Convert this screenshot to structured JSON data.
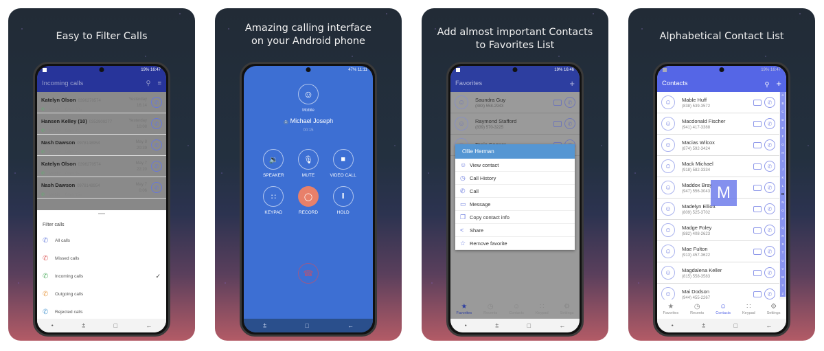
{
  "cards": [
    {
      "title": "Easy to Filter Calls",
      "status": {
        "signal": "… .il .il",
        "battery": "19%",
        "time": "16:47"
      },
      "appbar": {
        "title": "Incoming calls"
      },
      "calls": [
        {
          "name": "Katelyn Olson",
          "number": "0396270574",
          "type": "Mobile",
          "duration": "0min 20s",
          "date": "Yesterday",
          "time": "16:14"
        },
        {
          "name": "Hansen Kelley (10)",
          "number": "0352909277",
          "type": "Mobile",
          "duration": "0min 8s",
          "date": "Yesterday",
          "time": "10:08"
        },
        {
          "name": "Nash Dawson",
          "number": "0978148954",
          "type": "Mobile",
          "duration": "0min 6s",
          "date": "May 8",
          "time": "20:39"
        },
        {
          "name": "Katelyn Olson",
          "number": "0396270574",
          "type": "Mobile",
          "duration": "0min 9s",
          "date": "May 7",
          "time": "22:20"
        },
        {
          "name": "Nash Dawson",
          "number": "0978148954",
          "type": "Mobile",
          "duration": "0min 15s",
          "date": "May 7",
          "time": "0:06"
        }
      ],
      "sheet": {
        "title": "Filter calls",
        "items": [
          {
            "label": "All calls",
            "color": "#7b8ee0",
            "selected": false
          },
          {
            "label": "Missed calls",
            "color": "#e06b6b",
            "selected": false
          },
          {
            "label": "Incoming calls",
            "color": "#5bb36b",
            "selected": true
          },
          {
            "label": "Outgoing calls",
            "color": "#e8a04f",
            "selected": false
          },
          {
            "label": "Rejected calls",
            "color": "#5a9fd4",
            "selected": false
          }
        ],
        "check": "✓"
      }
    },
    {
      "title": "Amazing calling interface on your Android phone",
      "status": {
        "battery": "47%",
        "time": "11:11"
      },
      "call": {
        "label": "Mobile",
        "sim": "1",
        "name": "Michael Joseph",
        "timer": "00:15",
        "buttons": [
          {
            "label": "SPEAKER",
            "icon": "🔉"
          },
          {
            "label": "MUTE",
            "icon": "🎙"
          },
          {
            "label": "VIDEO CALL",
            "icon": "■"
          },
          {
            "label": "KEYPAD",
            "icon": "∷"
          },
          {
            "label": "RECORD",
            "icon": "◯"
          },
          {
            "label": "HOLD",
            "icon": "‖"
          }
        ],
        "hangup_icon": "☎"
      }
    },
    {
      "title": "Add almost important Contacts to Favorites List",
      "status": {
        "battery": "19%",
        "time": "16:46"
      },
      "appbar": {
        "title": "Favorites",
        "add": "+"
      },
      "favorites": [
        {
          "name": "Saundra Guy",
          "phone": "(883) 558-2943"
        },
        {
          "name": "Raymond Stafford",
          "phone": "(839) 570-3225"
        },
        {
          "name": "Tania Conner",
          "phone": ""
        }
      ],
      "menu": {
        "title": "Ollie Herman",
        "items": [
          {
            "label": "View contact",
            "icon": "☺"
          },
          {
            "label": "Call History",
            "icon": "◷"
          },
          {
            "label": "Call",
            "icon": "✆"
          },
          {
            "label": "Message",
            "icon": "▭"
          },
          {
            "label": "Copy contact info",
            "icon": "❐"
          },
          {
            "label": "Share",
            "icon": "<"
          },
          {
            "label": "Remove favorite",
            "icon": "☆"
          }
        ]
      },
      "tabs": [
        {
          "label": "Favorites",
          "icon": "★",
          "active": true
        },
        {
          "label": "Recents",
          "icon": "◷",
          "active": false
        },
        {
          "label": "Contacts",
          "icon": "☺",
          "active": false
        },
        {
          "label": "Keypad",
          "icon": "∷",
          "active": false
        },
        {
          "label": "Settings",
          "icon": "⚙",
          "active": false
        }
      ]
    },
    {
      "title": "Alphabetical Contact List",
      "status": {
        "battery": "19%",
        "time": "16:47"
      },
      "appbar": {
        "title": "Contacts",
        "add": "+"
      },
      "contacts": [
        {
          "name": "Mable Huff",
          "phone": "(838) 539-3572"
        },
        {
          "name": "Macdonald Fischer",
          "phone": "(941) 417-3388"
        },
        {
          "name": "Macias Wilcox",
          "phone": "(874) 592-3424"
        },
        {
          "name": "Mack Michael",
          "phone": "(918) 582-3334"
        },
        {
          "name": "Maddox Bray",
          "phone": "(947) 556-3043"
        },
        {
          "name": "Madelyn Elliott",
          "phone": "(809) 525-3702"
        },
        {
          "name": "Madge Foley",
          "phone": "(882) 408-2623"
        },
        {
          "name": "Mae Fulton",
          "phone": "(913) 457-3622"
        },
        {
          "name": "Magdalena Keller",
          "phone": "(815) 558-3583"
        },
        {
          "name": "Mai Dodson",
          "phone": "(944) 455-2267"
        }
      ],
      "index_letters": [
        "A",
        "B",
        "C",
        "D",
        "E",
        "F",
        "G",
        "H",
        "I",
        "J",
        "K",
        "L",
        "M",
        "N",
        "O",
        "P",
        "Q",
        "R",
        "S",
        "T",
        "U",
        "V",
        "W",
        "Y",
        "Z"
      ],
      "index_popup": "M",
      "tabs": [
        {
          "label": "Favorites",
          "icon": "★",
          "active": false
        },
        {
          "label": "Recents",
          "icon": "◷",
          "active": false
        },
        {
          "label": "Contacts",
          "icon": "☺",
          "active": true
        },
        {
          "label": "Keypad",
          "icon": "∷",
          "active": false
        },
        {
          "label": "Settings",
          "icon": "⚙",
          "active": false
        }
      ]
    }
  ],
  "nav": {
    "recents": "⩲",
    "home": "□",
    "back": "←",
    "dot": "•"
  },
  "colors": {
    "primary": "#3f51c9",
    "call_bg": "#3d6fd3",
    "record": "#e8806a",
    "menu_header": "#5596d3",
    "index_bar": "#8893f0"
  }
}
